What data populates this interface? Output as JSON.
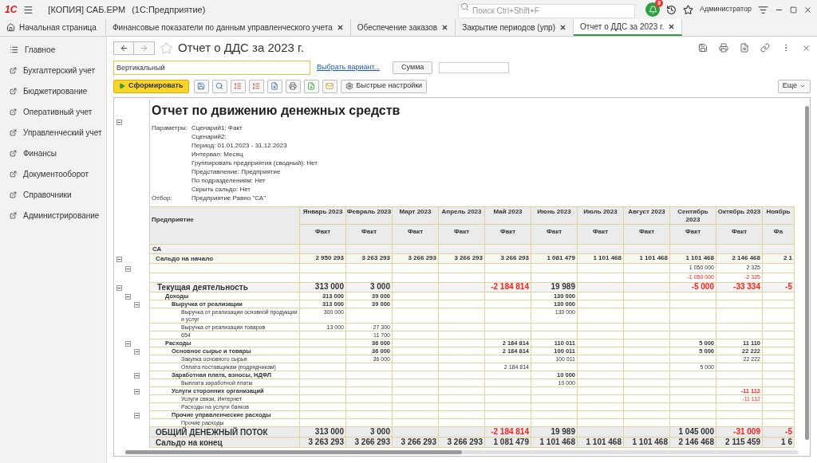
{
  "app": {
    "logo": "1С",
    "title": "[КОПИЯ] САБ.ЕРМ",
    "subtitle": "(1С:Предприятие)",
    "search": {
      "placeholder": "Поиск Ctrl+Shift+F"
    },
    "notifications": "3",
    "user": "Администратор"
  },
  "tabs": [
    {
      "label": "Начальная страница",
      "kind": "home",
      "selected": false
    },
    {
      "label": "Финансовые показатели по данным управленческого учета",
      "kind": "doc",
      "selected": false
    },
    {
      "label": "Обеспечение заказов",
      "kind": "doc",
      "selected": false
    },
    {
      "label": "Закрытие периодов (упр)",
      "kind": "doc",
      "selected": false
    },
    {
      "label": "Отчет о ДДС за 2023 г.",
      "kind": "doc",
      "selected": true
    }
  ],
  "sidebar": {
    "items": [
      {
        "label": "Главное",
        "kind": "main"
      },
      {
        "label": "Бухгалтерский учет",
        "kind": "section"
      },
      {
        "label": "Бюджетирование",
        "kind": "section"
      },
      {
        "label": "Оперативный учет",
        "kind": "section"
      },
      {
        "label": "Управленческий учет",
        "kind": "section"
      },
      {
        "label": "Финансы",
        "kind": "section"
      },
      {
        "label": "Документооборот",
        "kind": "section"
      },
      {
        "label": "Справочники",
        "kind": "section"
      },
      {
        "label": "Администрирование",
        "kind": "section"
      }
    ]
  },
  "form": {
    "title": "Отчет о ДДС за 2023 г.",
    "variant": "Вертикальный",
    "choose_variant": "Выбрать вариант...",
    "sum_button": "Сумма",
    "generate_button": "Сформировать",
    "quick_settings": "Быстрые настройки",
    "more": "Еще"
  },
  "report": {
    "title": "Отчет по движению денежных средств",
    "parameters_label": "Параметры:",
    "parameters": [
      "Сценарий1: Факт",
      "Сценарий2:",
      "Период: 01.01.2023 - 31.12.2023",
      "Интервал: Месяц",
      "Группировать предприятия (сводный): Нет",
      "Представление: Предприятие",
      "По подразделениям: Нет",
      "Скрыть сальдо: Нет"
    ],
    "filter_label": "Отбор:",
    "filter": "Предприятие Равно \"СА\""
  },
  "table": {
    "label_column": "Предприятие",
    "columns": [
      {
        "period": "Январь 2023",
        "scenario": "Факт"
      },
      {
        "period": "Февраль 2023",
        "scenario": "Факт"
      },
      {
        "period": "Март 2023",
        "scenario": "Факт"
      },
      {
        "period": "Апрель 2023",
        "scenario": "Факт"
      },
      {
        "period": "Май 2023",
        "scenario": "Факт"
      },
      {
        "period": "Июнь 2023",
        "scenario": "Факт"
      },
      {
        "period": "Июль 2023",
        "scenario": "Факт"
      },
      {
        "period": "Август 2023",
        "scenario": "Факт"
      },
      {
        "period": "Сентябрь 2023",
        "scenario": "Факт"
      },
      {
        "period": "Октябрь 2023",
        "scenario": "Факт"
      },
      {
        "period": "Ноябрь",
        "scenario": "Фа"
      }
    ],
    "rows": [
      {
        "label": "СА",
        "kind": "org",
        "cells": [
          null,
          null,
          null,
          null,
          null,
          null,
          null,
          null,
          null,
          null,
          null
        ]
      },
      {
        "label": "Сальдо на начало",
        "kind": "balance",
        "expanded": true,
        "cells": [
          "2 950 293",
          "3 263 293",
          "3 266 293",
          "3 266 293",
          "3 266 293",
          "1 081 479",
          "1 101 468",
          "1 101 468",
          "1 101 468",
          "2 146 468",
          "2 1"
        ],
        "children": [
          {
            "kind": "blank",
            "expanded": true,
            "cells": [
              null,
              null,
              null,
              null,
              null,
              null,
              null,
              null,
              "1 050 000",
              "2 325",
              null
            ],
            "children": [
              {
                "kind": "blank",
                "cells": [
                  null,
                  null,
                  null,
                  null,
                  null,
                  null,
                  null,
                  null,
                  {
                    "text": "-1 050 000",
                    "red": true
                  },
                  {
                    "text": "-2 325",
                    "red": true
                  },
                  null
                ]
              }
            ]
          }
        ]
      },
      {
        "label": "Текущая деятельность",
        "kind": "section",
        "expanded": true,
        "cells": [
          "313 000",
          "3 000",
          null,
          null,
          {
            "text": "-2 184 814",
            "red": true
          },
          "19 989",
          null,
          null,
          {
            "text": "-5 000",
            "red": true
          },
          {
            "text": "-33 334",
            "red": true
          },
          {
            "text": "-5",
            "red": true
          }
        ],
        "children": [
          {
            "label": "Доходы",
            "kind": "group",
            "expanded": true,
            "cells": [
              "313 000",
              "39 000",
              null,
              null,
              null,
              "130 000",
              null,
              null,
              null,
              null,
              null
            ],
            "children": [
              {
                "label": "Выручка от реализации",
                "kind": "group",
                "expanded": true,
                "cells": [
                  "313 000",
                  "39 000",
                  null,
                  null,
                  null,
                  "130 000",
                  null,
                  null,
                  null,
                  null,
                  null
                ],
                "children": [
                  {
                    "label": "Выручка от реализации основной продукции и услуг",
                    "kind": "item",
                    "cells": [
                      "300 000",
                      null,
                      null,
                      null,
                      null,
                      "130 000",
                      null,
                      null,
                      null,
                      null,
                      null
                    ]
                  },
                  {
                    "label": "Выручка от реализации товаров",
                    "kind": "item",
                    "cells": [
                      "13 000",
                      "27 300",
                      null,
                      null,
                      null,
                      null,
                      null,
                      null,
                      null,
                      null,
                      null
                    ]
                  },
                  {
                    "label": "654",
                    "kind": "item",
                    "cells": [
                      null,
                      "11 700",
                      null,
                      null,
                      null,
                      null,
                      null,
                      null,
                      null,
                      null,
                      null
                    ]
                  }
                ]
              }
            ]
          },
          {
            "label": "Расходы",
            "kind": "group",
            "expanded": true,
            "cells": [
              null,
              "36 000",
              null,
              null,
              "2 184 814",
              "110 011",
              null,
              null,
              "5 000",
              "11 110",
              null
            ],
            "children": [
              {
                "label": "Основное сырье и товары",
                "kind": "group",
                "expanded": true,
                "cells": [
                  null,
                  "36 000",
                  null,
                  null,
                  "2 184 814",
                  "100 011",
                  null,
                  null,
                  "5 000",
                  "22 222",
                  null
                ],
                "children": [
                  {
                    "label": "Закупка основного сырья",
                    "kind": "item",
                    "cells": [
                      null,
                      "36 000",
                      null,
                      null,
                      null,
                      "100 011",
                      null,
                      null,
                      null,
                      "22 222",
                      null
                    ]
                  },
                  {
                    "label": "Оплата поставщикам (подрядчикам)",
                    "kind": "item",
                    "cells": [
                      null,
                      null,
                      null,
                      null,
                      "2 184 814",
                      null,
                      null,
                      null,
                      "5 000",
                      null,
                      null
                    ]
                  }
                ]
              },
              {
                "label": "Заработная плата, взносы, НДФЛ",
                "kind": "group",
                "expanded": true,
                "cells": [
                  null,
                  null,
                  null,
                  null,
                  null,
                  "10 000",
                  null,
                  null,
                  null,
                  null,
                  null
                ],
                "children": [
                  {
                    "label": "Выплата заработной платы",
                    "kind": "item",
                    "cells": [
                      null,
                      null,
                      null,
                      null,
                      null,
                      "10 000",
                      null,
                      null,
                      null,
                      null,
                      null
                    ]
                  }
                ]
              },
              {
                "label": "Услуги сторонних организаций",
                "kind": "group",
                "expanded": true,
                "cells": [
                  null,
                  null,
                  null,
                  null,
                  null,
                  null,
                  null,
                  null,
                  null,
                  {
                    "text": "-11 112",
                    "red": true
                  },
                  null
                ],
                "children": [
                  {
                    "label": "Услуги связи, Интернет",
                    "kind": "item",
                    "cells": [
                      null,
                      null,
                      null,
                      null,
                      null,
                      null,
                      null,
                      null,
                      null,
                      {
                        "text": "-11 112",
                        "red": true
                      },
                      null
                    ]
                  },
                  {
                    "label": "Расходы на услуги банков",
                    "kind": "item",
                    "cells": [
                      null,
                      null,
                      null,
                      null,
                      null,
                      null,
                      null,
                      null,
                      null,
                      null,
                      null
                    ]
                  }
                ]
              },
              {
                "label": "Прочие управленческие расходы",
                "kind": "group",
                "expanded": true,
                "cells": [
                  null,
                  null,
                  null,
                  null,
                  null,
                  null,
                  null,
                  null,
                  null,
                  null,
                  null
                ],
                "children": [
                  {
                    "label": "Прочие расходы",
                    "kind": "item",
                    "cells": [
                      null,
                      null,
                      null,
                      null,
                      null,
                      null,
                      null,
                      null,
                      null,
                      null,
                      null
                    ]
                  }
                ]
              }
            ]
          }
        ]
      },
      {
        "label": "ОБЩИЙ ДЕНЕЖНЫЙ ПОТОК",
        "kind": "total",
        "cells": [
          "313 000",
          "3 000",
          null,
          null,
          {
            "text": "-2 184 814",
            "red": true
          },
          "19 989",
          null,
          null,
          "1 045 000",
          {
            "text": "-31 009",
            "red": true
          },
          {
            "text": "-5",
            "red": true
          }
        ]
      },
      {
        "label": "Сальдо на конец",
        "kind": "total",
        "cells": [
          "3 263 293",
          "3 266 293",
          "3 266 293",
          "3 266 293",
          "1 081 479",
          "1 101 468",
          "1 101 468",
          "1 101 468",
          "2 146 468",
          "2 115 459",
          "1 6"
        ]
      }
    ]
  }
}
